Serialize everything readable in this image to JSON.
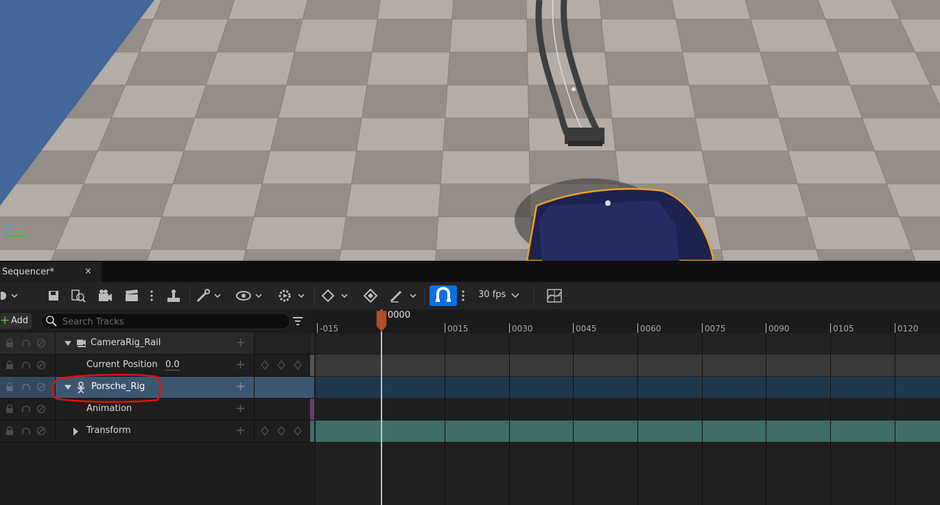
{
  "viewport": {
    "axis_z": "Z",
    "axis_y": "Y",
    "colors": {
      "sky": "#44679a",
      "floor_light": "#a9a29d",
      "floor_dark": "#8b847f",
      "car": "#1c2350",
      "outline": "#f0a020"
    }
  },
  "sequencer": {
    "tab_title": "Sequencer*",
    "close_glyph": "×",
    "toolbar": {
      "fps_label": "30 fps",
      "icons": [
        "settings-icon",
        "save-icon",
        "find-in-browser-icon",
        "camera-icon",
        "clapper-icon",
        "more-options-icon",
        "actor-to-sequencer-icon",
        "tools-icon",
        "visibility-icon",
        "playback-settings-icon",
        "key-icon",
        "auto-key-icon",
        "edit-mode-icon",
        "snap-icon",
        "curve-editor-icon"
      ]
    },
    "add_label": "Add",
    "add_plus": "+",
    "search_placeholder": "Search Tracks",
    "tracks": [
      {
        "label": "CameraRig_Rail",
        "expanded": true,
        "icon": "camera-rig-icon",
        "selected": false
      },
      {
        "label": "Current Position",
        "value": "0.0",
        "child": true
      },
      {
        "label": "Porsche_Rig",
        "expanded": true,
        "icon": "skeleton-icon",
        "selected": true
      },
      {
        "label": "Animation",
        "child": true
      },
      {
        "label": "Transform",
        "child": true,
        "expandable": true
      }
    ],
    "current_frame": "0000",
    "ruler_labels": [
      "-015",
      "0015",
      "0030",
      "0045",
      "0060",
      "0075",
      "0090",
      "0105",
      "0120"
    ],
    "accent_colors": {
      "playhead": "#b0502a",
      "selection": "#3d5670",
      "transform_bar": "#3f6e66",
      "snap_active": "#0f6fe0",
      "annotation": "#e01010"
    }
  }
}
